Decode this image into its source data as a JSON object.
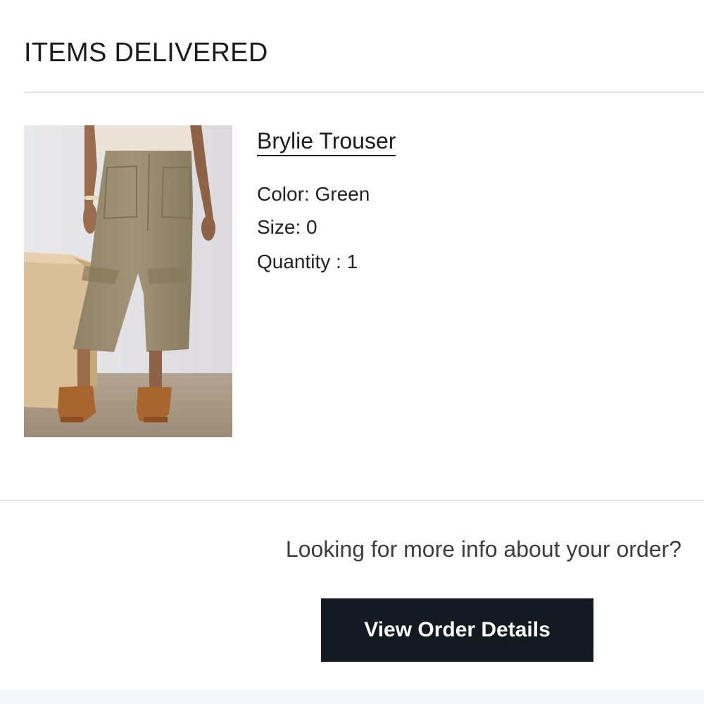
{
  "section": {
    "title": "ITEMS DELIVERED"
  },
  "item": {
    "name": "Brylie Trouser",
    "color_line": "Color: Green",
    "size_line": "Size: 0",
    "quantity_line": "Quantity : 1",
    "image_alt": "product-photo"
  },
  "footer": {
    "prompt": "Looking for more info about your order?",
    "button_label": "View Order Details"
  },
  "colors": {
    "button_bg": "#131a22",
    "button_text": "#ffffff",
    "divider": "#e4e4e4"
  }
}
